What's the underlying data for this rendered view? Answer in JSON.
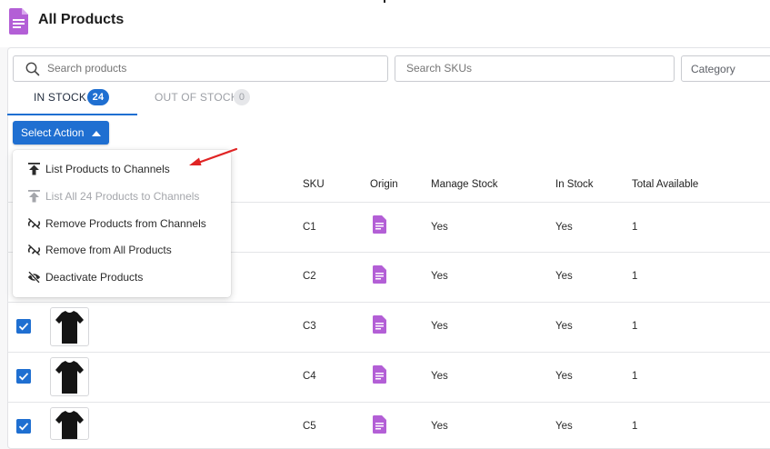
{
  "header": {
    "title": "All Products"
  },
  "filters": {
    "search_products_placeholder": "Search products",
    "search_skus_placeholder": "Search SKUs",
    "category_label": "Category"
  },
  "tabs": [
    {
      "label": "IN STOCK",
      "count": "24"
    },
    {
      "label": "OUT OF STOCK",
      "count": "0"
    }
  ],
  "select_action": {
    "label": "Select Action"
  },
  "menu": {
    "items": [
      {
        "label": "List Products to Channels",
        "icon": "upload-icon",
        "disabled": false
      },
      {
        "label": "List All 24 Products to Channels",
        "icon": "upload-icon",
        "disabled": true
      },
      {
        "label": "Remove Products from Channels",
        "icon": "unlink-icon",
        "disabled": false
      },
      {
        "label": "Remove from All Products",
        "icon": "unlink-icon",
        "disabled": false
      },
      {
        "label": "Deactivate Products",
        "icon": "eye-off-icon",
        "disabled": false
      }
    ]
  },
  "table": {
    "columns": [
      "SKU",
      "Origin",
      "Manage Stock",
      "In Stock",
      "Total Available"
    ],
    "rows": [
      {
        "sku": "C1",
        "manage_stock": "Yes",
        "in_stock": "Yes",
        "total": "1"
      },
      {
        "sku": "C2",
        "manage_stock": "Yes",
        "in_stock": "Yes",
        "total": "1"
      },
      {
        "sku": "C3",
        "manage_stock": "Yes",
        "in_stock": "Yes",
        "total": "1"
      },
      {
        "sku": "C4",
        "manage_stock": "Yes",
        "in_stock": "Yes",
        "total": "1"
      },
      {
        "sku": "C5",
        "manage_stock": "Yes",
        "in_stock": "Yes",
        "total": "1"
      }
    ]
  },
  "colors": {
    "accent": "#1f6fd1",
    "origin_icon": "#b35fd6",
    "annotation_arrow": "#e02424"
  }
}
